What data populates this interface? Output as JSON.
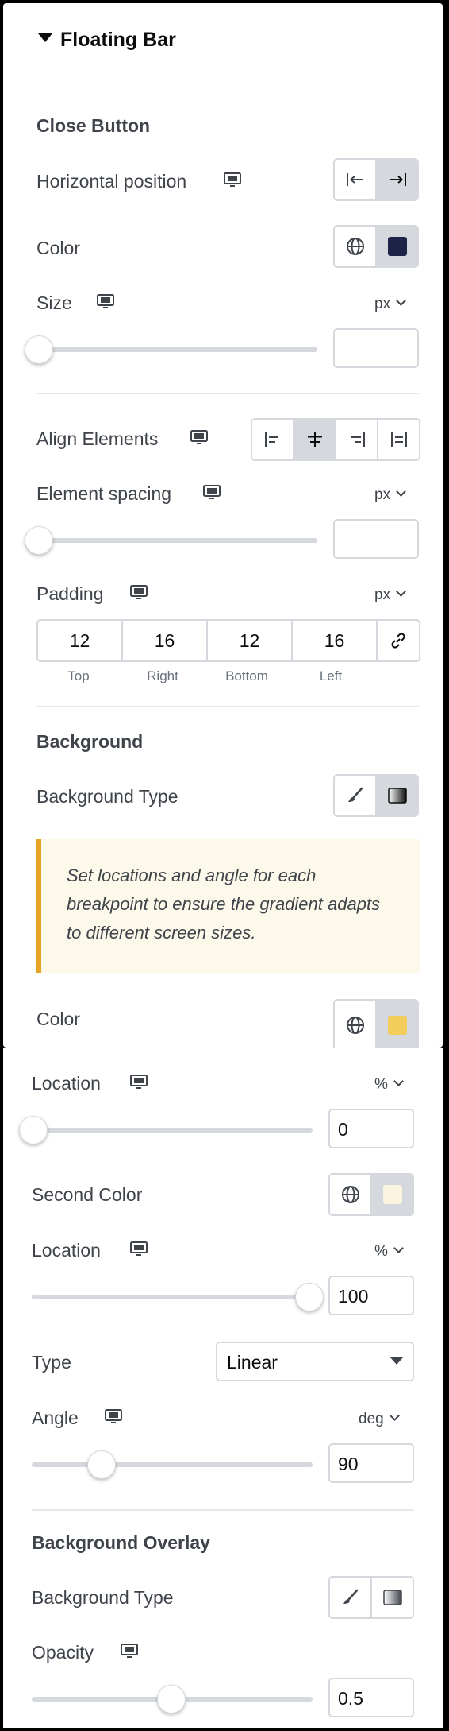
{
  "panel_title": "Floating Bar",
  "close_button": {
    "section": "Close Button",
    "horizontal_position_label": "Horizontal position",
    "color_label": "Color",
    "color_value": "#1e2448",
    "size_label": "Size",
    "size_unit": "px",
    "size_value": "",
    "size_fraction": 0
  },
  "align_elements_label": "Align Elements",
  "element_spacing": {
    "label": "Element spacing",
    "unit": "px",
    "value": "",
    "fraction": 0
  },
  "padding": {
    "label": "Padding",
    "unit": "px",
    "values": [
      "12",
      "16",
      "12",
      "16"
    ],
    "captions": [
      "Top",
      "Right",
      "Bottom",
      "Left"
    ]
  },
  "background": {
    "section": "Background",
    "type_label": "Background Type",
    "notice": "Set locations and angle for each breakpoint to ensure the gradient adapts to different screen sizes.",
    "color_label": "Color",
    "color_value": "#f2cd5c",
    "location1": {
      "label": "Location",
      "unit": "%",
      "value": "0",
      "fraction": 0
    },
    "second_color_label": "Second Color",
    "second_color_value": "#fbf5df",
    "location2": {
      "label": "Location",
      "unit": "%",
      "value": "100",
      "fraction": 1
    },
    "type_select_label": "Type",
    "type_select_value": "Linear",
    "angle": {
      "label": "Angle",
      "unit": "deg",
      "value": "90",
      "fraction": 0.25
    }
  },
  "background_overlay": {
    "section": "Background Overlay",
    "type_label": "Background Type",
    "opacity": {
      "label": "Opacity",
      "value": "0.5",
      "fraction": 0.5
    }
  }
}
